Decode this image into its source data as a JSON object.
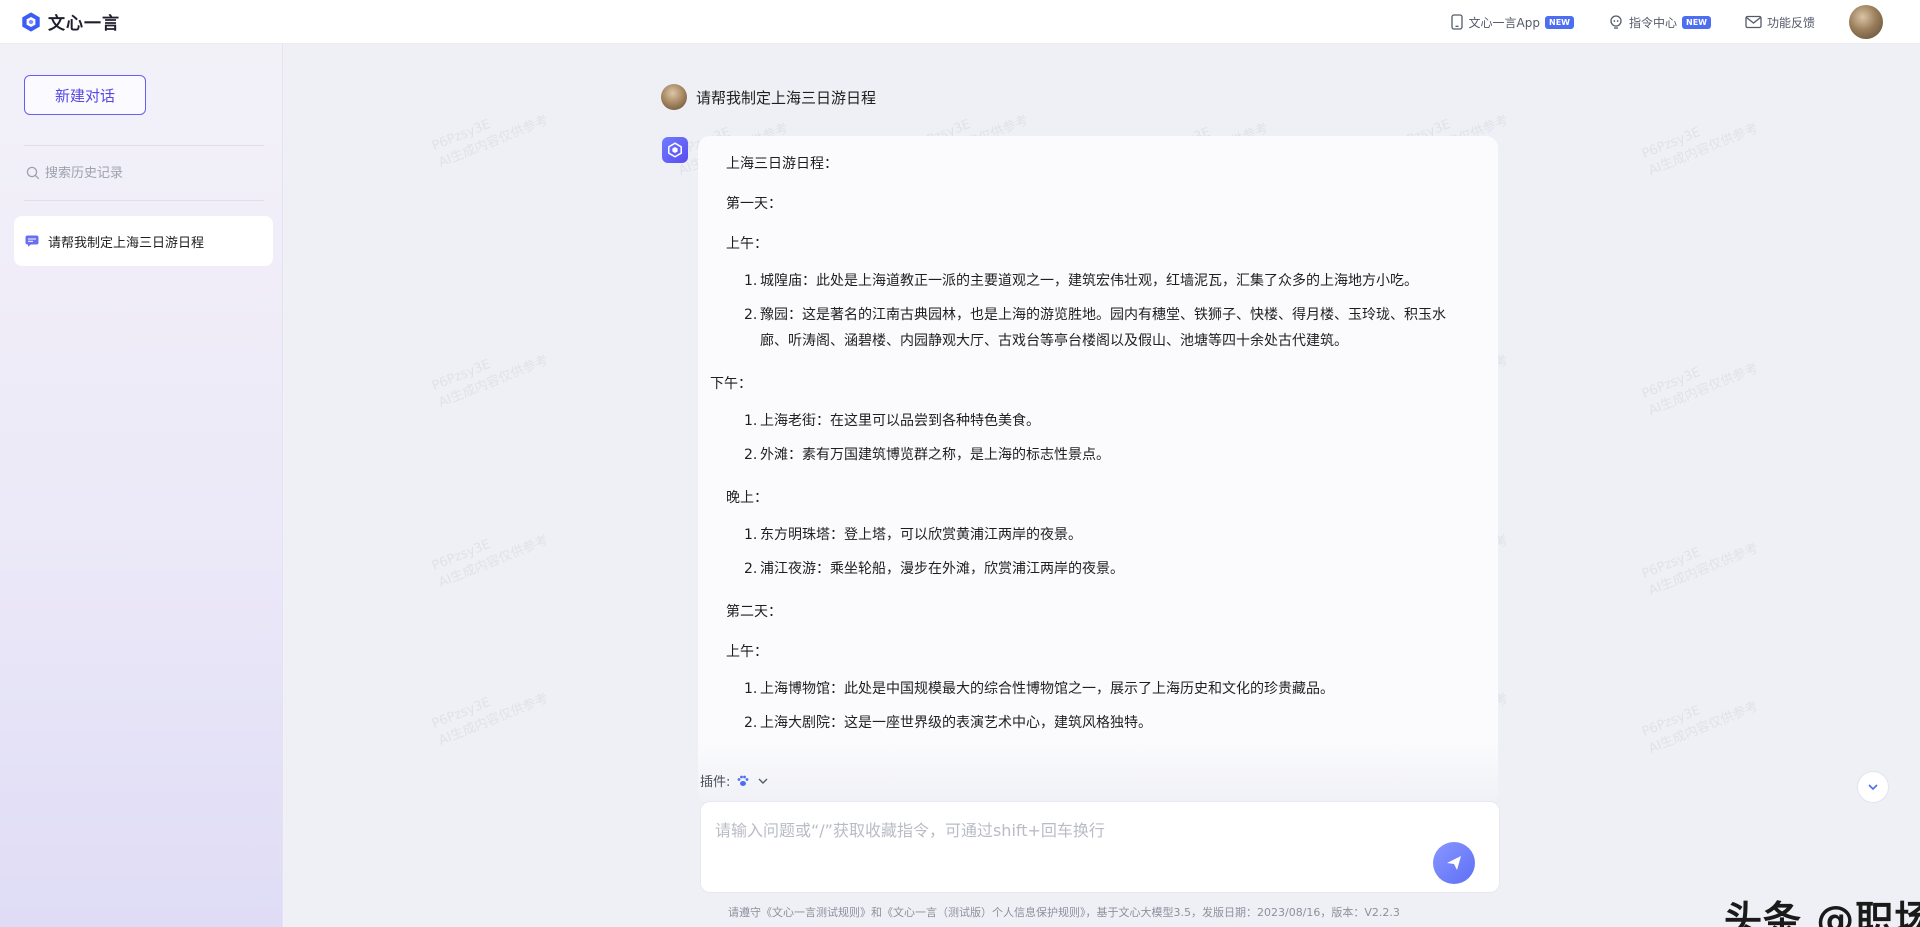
{
  "app": {
    "brand_name": "文心一言",
    "accent_color": "#5647e6",
    "badge_color": "#4e6ef2"
  },
  "topbar": {
    "actions": [
      {
        "label": "文心一言App",
        "icon": "phone-icon",
        "badge": "NEW"
      },
      {
        "label": "指令中心",
        "icon": "lightbulb-icon",
        "badge": "NEW"
      },
      {
        "label": "功能反馈",
        "icon": "mail-icon"
      }
    ]
  },
  "sidebar": {
    "new_chat_label": "新建对话",
    "search_placeholder": "搜索历史记录",
    "history": [
      {
        "label": "请帮我制定上海三日游日程",
        "icon": "chat-bubble-icon"
      }
    ]
  },
  "conversation": {
    "user_question": "请帮我制定上海三日游日程",
    "answer": {
      "title": "上海三日游日程：",
      "day1_label": "第一天：",
      "day1_morning_label": "上午：",
      "day1_morning_items": [
        "城隍庙：此处是上海道教正一派的主要道观之一，建筑宏伟壮观，红墙泥瓦，汇集了众多的上海地方小吃。",
        "豫园：这是著名的江南古典园林，也是上海的游览胜地。园内有穗堂、铁狮子、快楼、得月楼、玉玲珑、积玉水廊、听涛阁、涵碧楼、内园静观大厅、古戏台等亭台楼阁以及假山、池塘等四十余处古代建筑。"
      ],
      "day1_afternoon_label": "下午：",
      "day1_afternoon_items": [
        "上海老街：在这里可以品尝到各种特色美食。",
        "外滩：素有万国建筑博览群之称，是上海的标志性景点。"
      ],
      "day1_evening_label": "晚上：",
      "day1_evening_items": [
        "东方明珠塔：登上塔，可以欣赏黄浦江两岸的夜景。",
        "浦江夜游：乘坐轮船，漫步在外滩，欣赏浦江两岸的夜景。"
      ],
      "day2_label": "第二天：",
      "day2_morning_label": "上午：",
      "day2_morning_items": [
        "上海博物馆：此处是中国规模最大的综合性博物馆之一，展示了上海历史和文化的珍贵藏品。",
        "上海大剧院：这是一座世界级的表演艺术中心，建筑风格独特。"
      ]
    }
  },
  "composer": {
    "plugin_label": "插件:",
    "input_placeholder": "请输入问题或“/”获取收藏指令，可通过shift+回车换行"
  },
  "footer": {
    "note": "请遵守《文心一言测试规则》和《文心一言（测试版）个人信息保护规则》，基于文心大模型3.5，发版日期：2023/08/16，版本：V2.2.3"
  },
  "watermark": {
    "line1": "P6Pzsy3E",
    "line2": "AI生成内容仅供参考"
  },
  "overlay": {
    "text": "头条 @职场办公技能"
  }
}
